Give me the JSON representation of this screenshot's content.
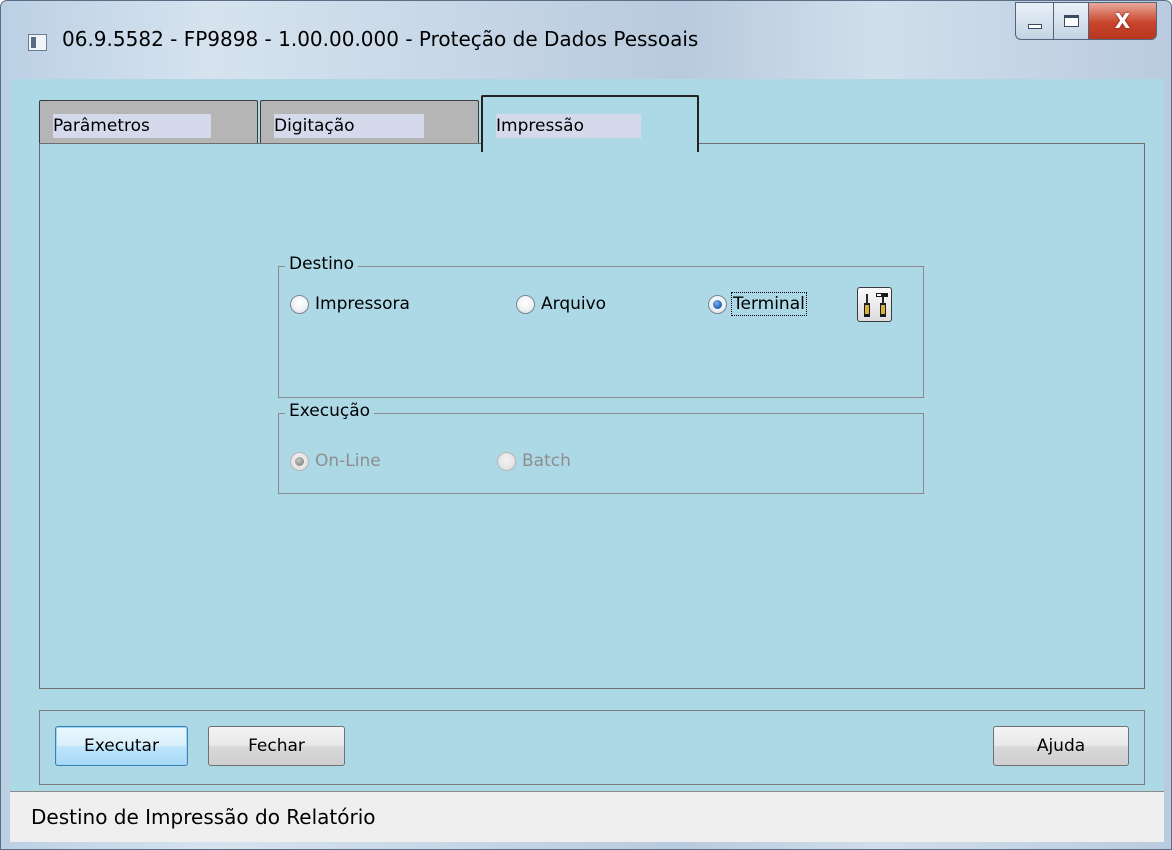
{
  "window": {
    "title": "06.9.5582 - FP9898 - 1.00.00.000 - Proteção de Dados Pessoais",
    "close_glyph": "X"
  },
  "tabs": [
    {
      "label": "Parâmetros",
      "active": false
    },
    {
      "label": "Digitação",
      "active": false
    },
    {
      "label": "Impressão",
      "active": true
    }
  ],
  "destino": {
    "label": "Destino",
    "options": [
      {
        "label": "Impressora",
        "checked": false
      },
      {
        "label": "Arquivo",
        "checked": false
      },
      {
        "label": "Terminal",
        "checked": true
      }
    ],
    "config_icon": "tools-icon"
  },
  "execucao": {
    "label": "Execução",
    "options": [
      {
        "label": "On-Line",
        "checked": true,
        "disabled": true
      },
      {
        "label": "Batch",
        "checked": false,
        "disabled": true
      }
    ]
  },
  "buttons": {
    "executar": "Executar",
    "fechar": "Fechar",
    "ajuda": "Ajuda"
  },
  "status": {
    "text": "Destino de Impressão do Relatório"
  },
  "colors": {
    "client_background": "#add8e6",
    "tab_inactive": "#b5b5b5",
    "tab_label_fill": "#d5d9ec"
  }
}
